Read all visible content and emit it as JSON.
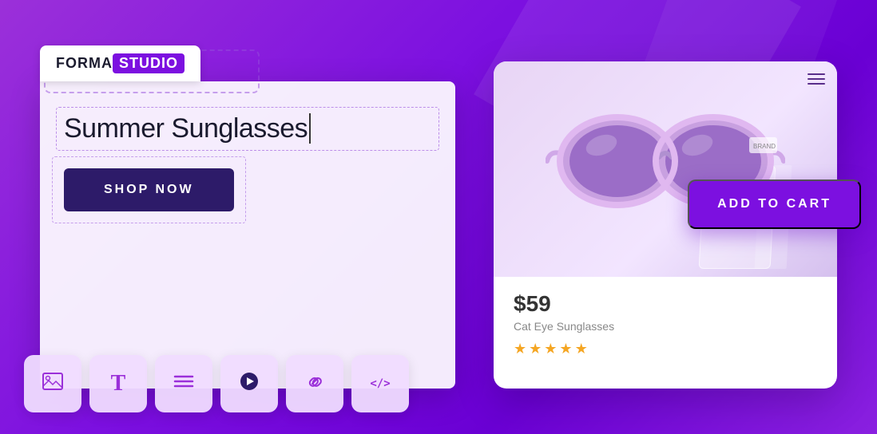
{
  "brand": {
    "forma": "FORMA",
    "studio": "STUDIO"
  },
  "editor": {
    "heading": "Summer Sunglasses",
    "shop_button": "SHOP NOW"
  },
  "product": {
    "price": "$59",
    "name": "Cat Eye Sunglasses",
    "stars": 5,
    "add_to_cart": "ADD TO CART"
  },
  "toolbar": {
    "items": [
      {
        "icon": "image-icon",
        "symbol": "🖼"
      },
      {
        "icon": "text-icon",
        "symbol": "T"
      },
      {
        "icon": "align-icon",
        "symbol": "≡"
      },
      {
        "icon": "video-icon",
        "symbol": "▶"
      },
      {
        "icon": "link-icon",
        "symbol": "🔗"
      },
      {
        "icon": "code-icon",
        "symbol": "</>"
      }
    ]
  },
  "colors": {
    "purple": "#7c10e0",
    "dark_purple": "#2d1b69",
    "light_purple": "#e8d5f5",
    "star_color": "#f5a623"
  }
}
